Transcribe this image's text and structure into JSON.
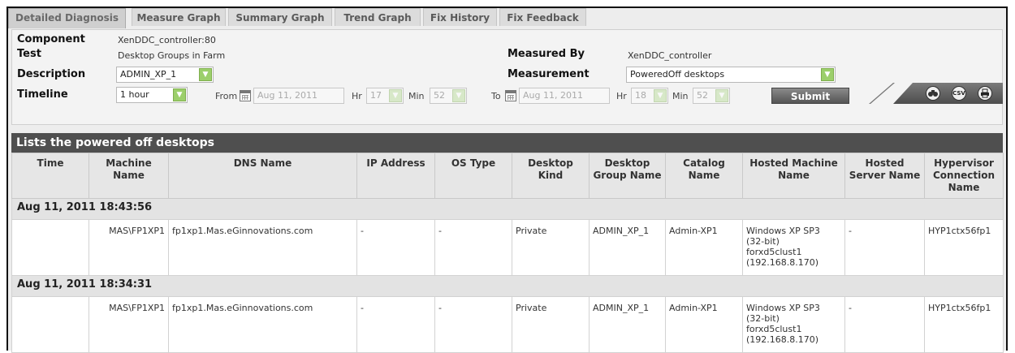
{
  "tabs": [
    {
      "label": "Detailed Diagnosis",
      "active": true
    },
    {
      "label": "Measure Graph",
      "active": false
    },
    {
      "label": "Summary Graph",
      "active": false
    },
    {
      "label": "Trend Graph",
      "active": false
    },
    {
      "label": "Fix History",
      "active": false
    },
    {
      "label": "Fix Feedback",
      "active": false
    }
  ],
  "info": {
    "component_label": "Component",
    "component_value": "XenDDC_controller:80",
    "test_label": "Test",
    "test_value": "Desktop Groups in Farm",
    "description_label": "Description",
    "description_value": "ADMIN_XP_1",
    "timeline_label": "Timeline",
    "timeline_value": "1 hour",
    "measured_by_label": "Measured By",
    "measured_by_value": "XenDDC_controller",
    "measurement_label": "Measurement",
    "measurement_value": "PoweredOff desktops"
  },
  "range": {
    "from_label": "From",
    "from_date": "Aug 11, 2011",
    "from_hr_label": "Hr",
    "from_hr": "17",
    "from_min_label": "Min",
    "from_min": "52",
    "to_label": "To",
    "to_date": "Aug 11, 2011",
    "to_hr_label": "Hr",
    "to_hr": "18",
    "to_min_label": "Min",
    "to_min": "52",
    "submit_label": "Submit"
  },
  "tools": {
    "binoculars": "binoculars-icon",
    "csv": "CSV",
    "print": "print-icon"
  },
  "table": {
    "title": "Lists the powered off desktops",
    "columns": [
      "Time",
      "Machine Name",
      "DNS Name",
      "IP Address",
      "OS Type",
      "Desktop Kind",
      "Desktop Group Name",
      "Catalog Name",
      "Hosted Machine Name",
      "Hosted Server Name",
      "Hypervisor Connection Name"
    ],
    "groups": [
      {
        "timestamp": "Aug 11, 2011 18:43:56",
        "row": {
          "time": "",
          "machine": "MAS\\FP1XP1",
          "dns": "fp1xp1.Mas.eGinnovations.com",
          "ip": "-",
          "os": "-",
          "kind": "Private",
          "group": "ADMIN_XP_1",
          "catalog": "Admin-XP1",
          "hosted_l1": "Windows XP SP3",
          "hosted_l2": "(32-bit)",
          "hosted_l3": "forxd5clust1",
          "hosted_l4": "(192.168.8.170)",
          "server": "-",
          "hypervisor": "HYP1ctx56fp1"
        }
      },
      {
        "timestamp": "Aug 11, 2011 18:34:31",
        "row": {
          "time": "",
          "machine": "MAS\\FP1XP1",
          "dns": "fp1xp1.Mas.eGinnovations.com",
          "ip": "-",
          "os": "-",
          "kind": "Private",
          "group": "ADMIN_XP_1",
          "catalog": "Admin-XP1",
          "hosted_l1": "Windows XP SP3",
          "hosted_l2": "(32-bit)",
          "hosted_l3": "forxd5clust1",
          "hosted_l4": "(192.168.8.170)",
          "server": "-",
          "hypervisor": "HYP1ctx56fp1"
        }
      }
    ]
  }
}
